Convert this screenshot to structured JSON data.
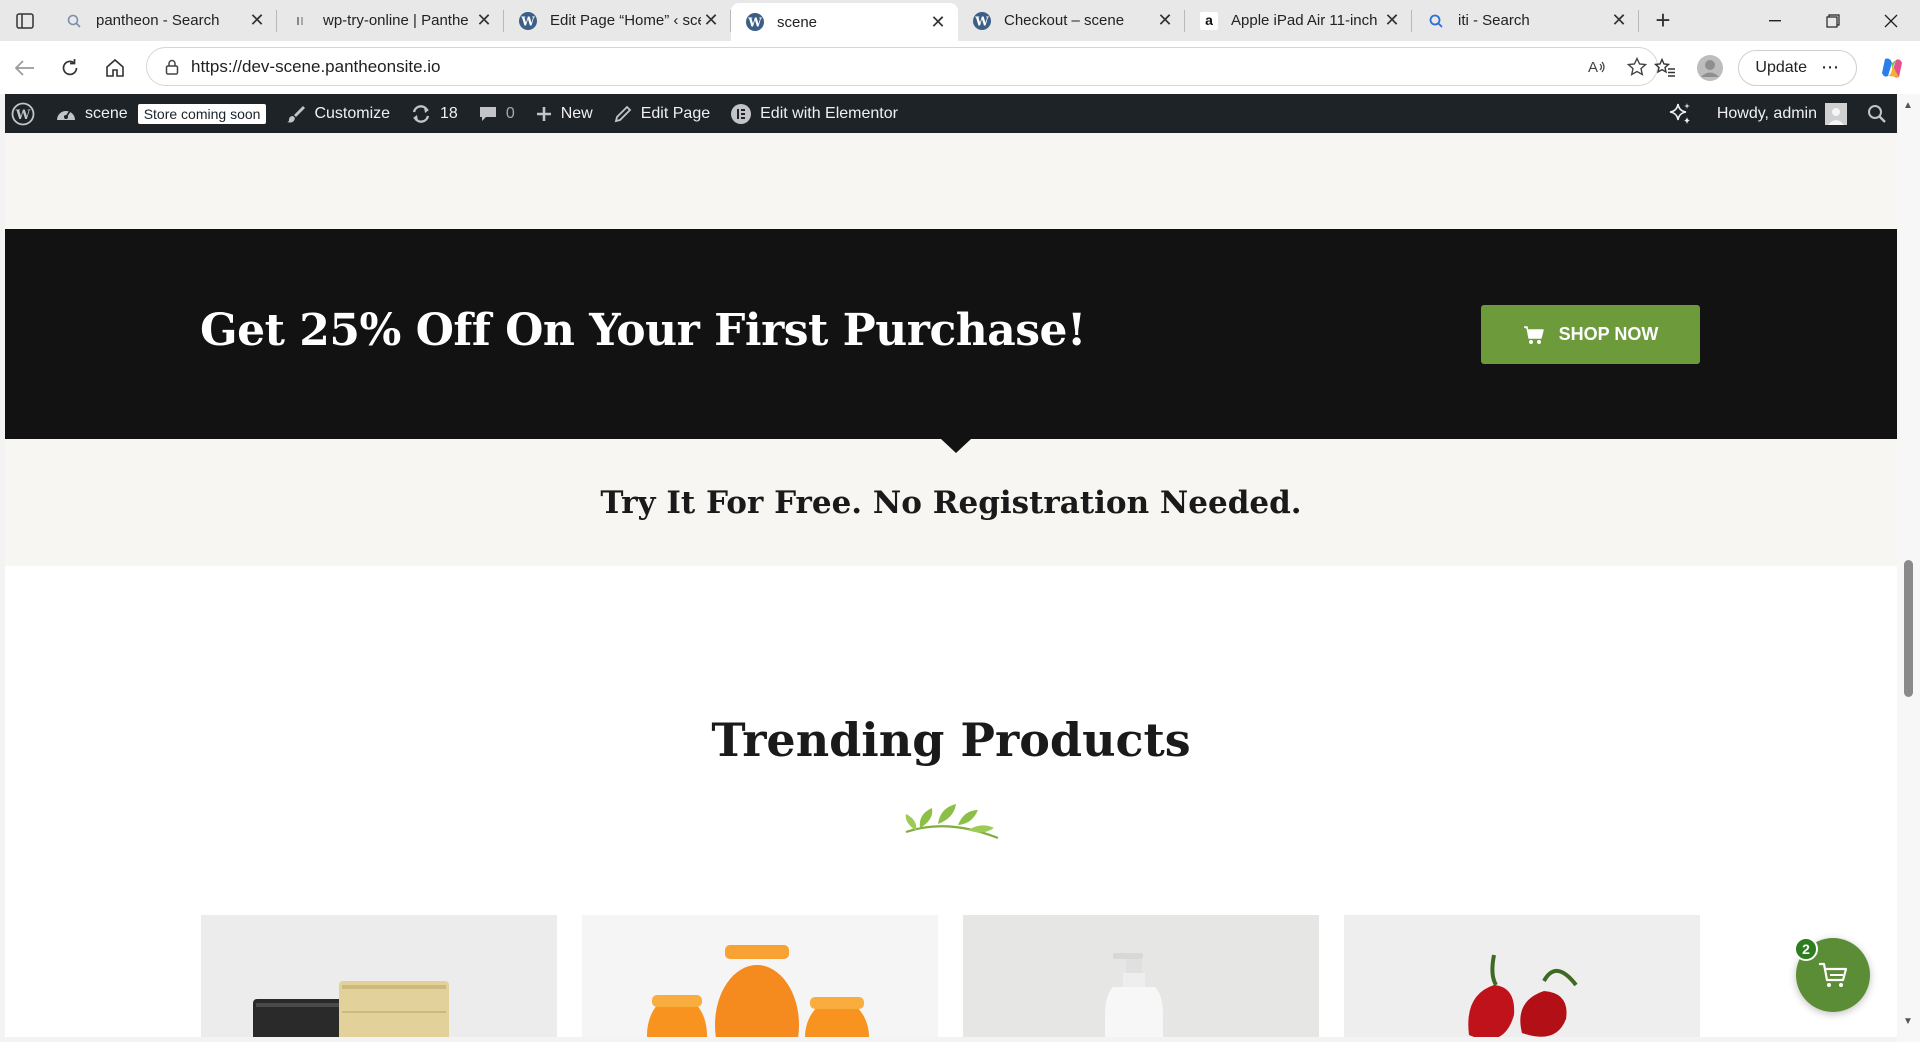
{
  "browser": {
    "tabs": [
      {
        "title": "pantheon - Search",
        "favicon": "search-icon"
      },
      {
        "title": "wp-try-online | Panthe",
        "favicon": "pantheon-icon"
      },
      {
        "title": "Edit Page “Home” ‹ sce",
        "favicon": "wordpress-icon"
      },
      {
        "title": "scene",
        "favicon": "wordpress-icon",
        "active": true
      },
      {
        "title": "Checkout – scene",
        "favicon": "wordpress-icon"
      },
      {
        "title": "Apple iPad Air 11-inch",
        "favicon": "amazon-icon"
      },
      {
        "title": "iti - Search",
        "favicon": "search-icon"
      }
    ],
    "url": "https://dev-scene.pantheonsite.io",
    "update_label": "Update"
  },
  "adminbar": {
    "site_name": "scene",
    "store_badge": "Store coming soon",
    "customize": "Customize",
    "updates_count": "18",
    "comments_count": "0",
    "new_label": "New",
    "edit_page": "Edit Page",
    "edit_elementor": "Edit with Elementor",
    "howdy": "Howdy, admin"
  },
  "promo": {
    "title": "Get 25% Off On Your First Purchase!",
    "button_label": "SHOP NOW"
  },
  "free_band": {
    "text": "Try It For Free. No Registration Needed."
  },
  "trending": {
    "title": "Trending Products",
    "products": [
      {
        "name": "product-pouches"
      },
      {
        "name": "product-jars"
      },
      {
        "name": "product-bottle"
      },
      {
        "name": "product-peppers"
      }
    ]
  },
  "cart": {
    "count": "2"
  },
  "colors": {
    "accent_green": "#6d9a3b",
    "admin_bar": "#1d2327",
    "promo_bg": "#121212",
    "band_bg": "#f7f6f3"
  }
}
